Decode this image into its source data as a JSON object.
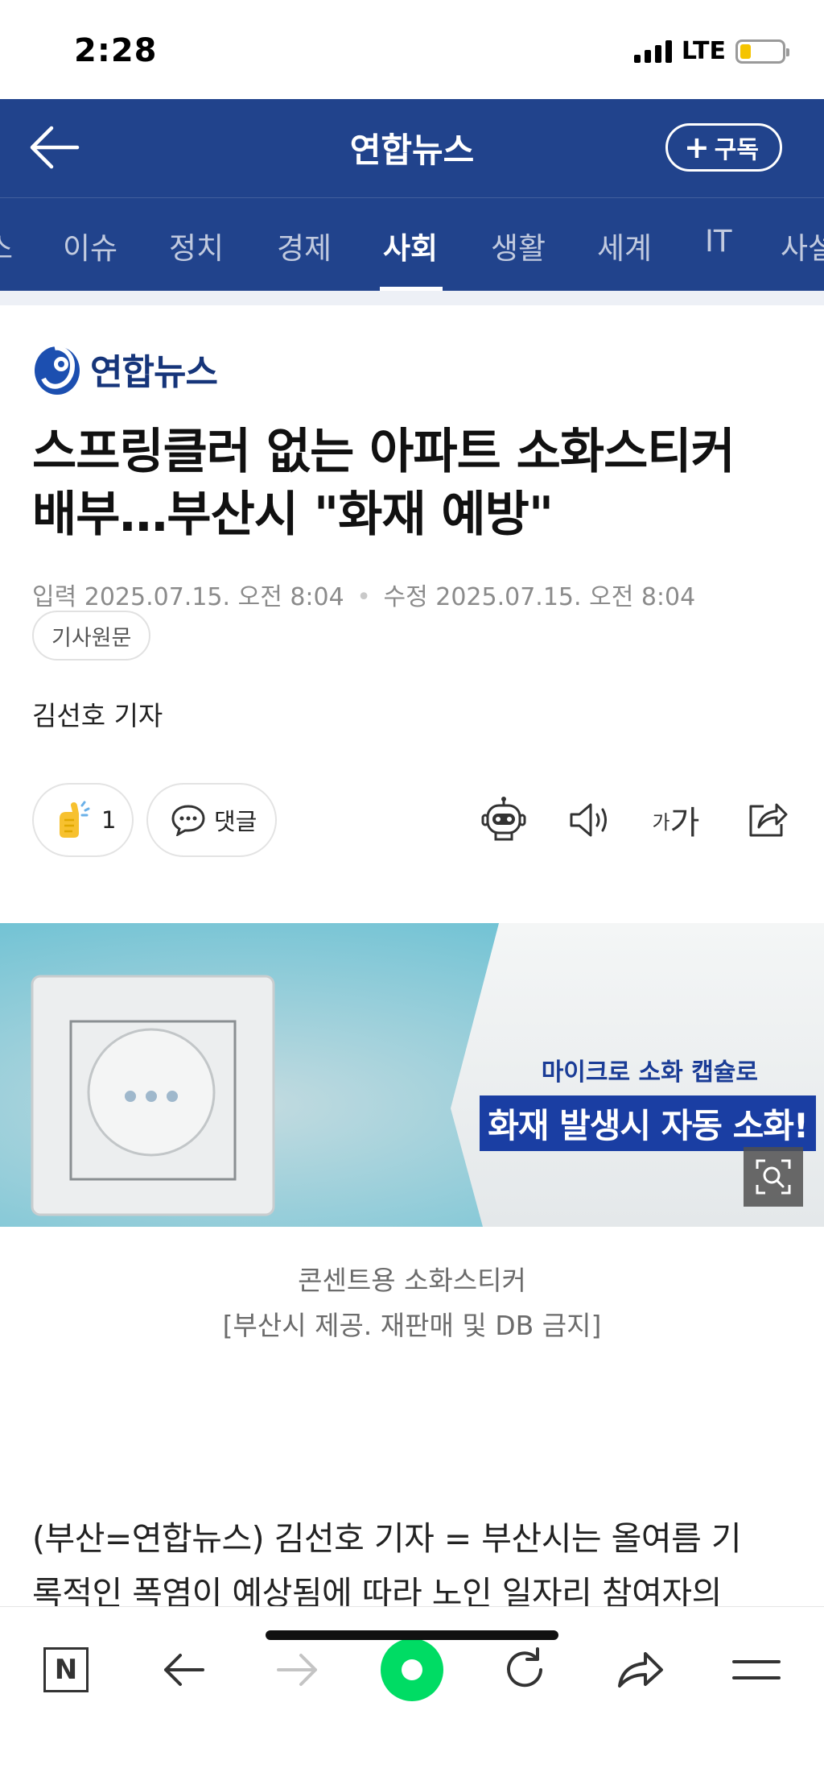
{
  "status_bar": {
    "time": "2:28",
    "network": "LTE"
  },
  "header": {
    "title": "연합뉴스",
    "subscribe_label": "구독"
  },
  "category_tabs": [
    {
      "label": "스",
      "active": false
    },
    {
      "label": "이슈",
      "active": false
    },
    {
      "label": "정치",
      "active": false
    },
    {
      "label": "경제",
      "active": false
    },
    {
      "label": "사회",
      "active": true
    },
    {
      "label": "생활",
      "active": false
    },
    {
      "label": "세계",
      "active": false
    },
    {
      "label": "IT",
      "active": false
    },
    {
      "label": "사설",
      "active": false
    }
  ],
  "article": {
    "press_name": "연합뉴스",
    "headline": "스프링클러 없는 아파트 소화스티커 배부…부산시 \"화재 예방\"",
    "input_label": "입력",
    "input_date": "2025.07.15. 오전 8:04",
    "modified_label": "수정",
    "modified_date": "2025.07.15. 오전 8:04",
    "original_button": "기사원문",
    "reporter": "김선호 기자",
    "like_count": "1",
    "comment_label": "댓글",
    "font_small": "가",
    "font_large": "가",
    "image_text_sub": "마이크로 소화 캡슐로",
    "image_text_main": "화재 발생시 자동 소화!",
    "caption_line1": "콘센트용 소화스티커",
    "caption_line2": "[부산시 제공. 재판매 및 DB 금지]",
    "body_line1": "(부산=연합뉴스) 김선호 기자 = 부산시는 올여름 기",
    "body_line2": "록적인 폭염이 예상됨에 따라 노인 일자리 참여자의"
  },
  "bottom_bar": {
    "n_label": "N"
  },
  "icons": [
    "back-arrow-icon",
    "plus-icon",
    "press-logo-icon",
    "like-hand-icon",
    "comment-bubble-icon",
    "robot-summary-icon",
    "speaker-icon",
    "font-size-icon",
    "share-icon",
    "zoom-icon",
    "naver-n-icon",
    "nav-back-icon",
    "nav-forward-icon",
    "green-home-icon",
    "refresh-icon",
    "share-arrow-icon",
    "menu-icon"
  ],
  "colors": {
    "header_blue": "#21438c",
    "brand_green": "#00dc64",
    "press_navy": "#16357a"
  }
}
